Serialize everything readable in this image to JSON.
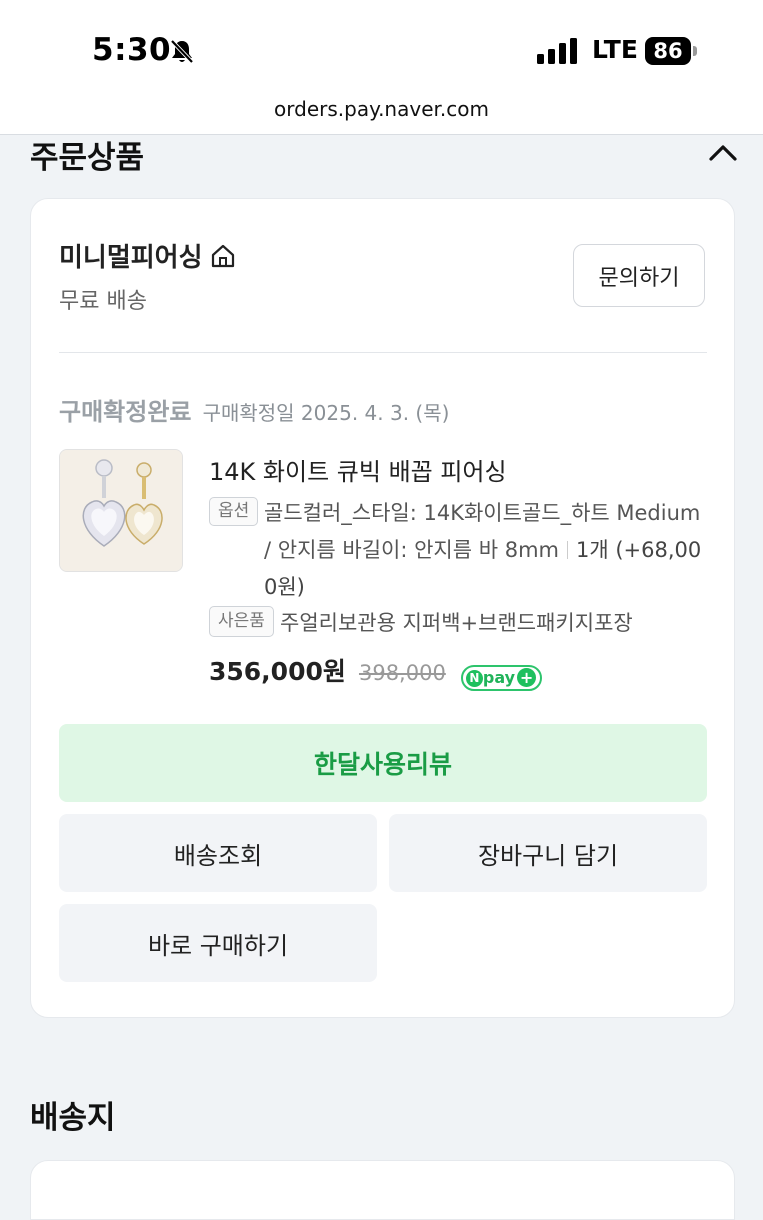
{
  "status_bar": {
    "time": "5:30",
    "network": "LTE",
    "battery": "86",
    "icons": [
      "bell-off-icon",
      "signal-icon",
      "battery-icon"
    ]
  },
  "browser": {
    "url": "orders.pay.naver.com"
  },
  "order_section": {
    "title": "주문상품",
    "collapse_icon": "chevron-up-icon"
  },
  "store": {
    "name": "미니멀피어싱",
    "home_icon": "home-icon",
    "shipping": "무료 배송",
    "inquiry_button": "문의하기"
  },
  "order": {
    "status": "구매확정완료",
    "confirm_date": "구매확정일 2025. 4. 3. (목)",
    "product_name": "14K 화이트 큐빅 배꼽 피어싱",
    "option_label": "옵션",
    "option_text": "골드컬러_스타일: 14K화이트골드_하트 Medium / 안지름 바길이: 안지름 바 8mm",
    "quantity_text": "1개 (+68,000원)",
    "gift_label": "사은품",
    "gift_text": "주얼리보관용 지퍼백+브랜드패키지포장",
    "price": "356,000원",
    "original_price": "398,000",
    "pay_badge": "pay"
  },
  "actions": {
    "review": "한달사용리뷰",
    "track_delivery": "배송조회",
    "add_to_cart": "장바구니 담기",
    "buy_now": "바로 구매하기"
  },
  "delivery_section": {
    "title": "배송지"
  },
  "colors": {
    "review_bg": "#dff7e5",
    "review_text": "#1a9c45",
    "npay_green": "#1ec05e",
    "page_bg": "#f0f3f6"
  }
}
